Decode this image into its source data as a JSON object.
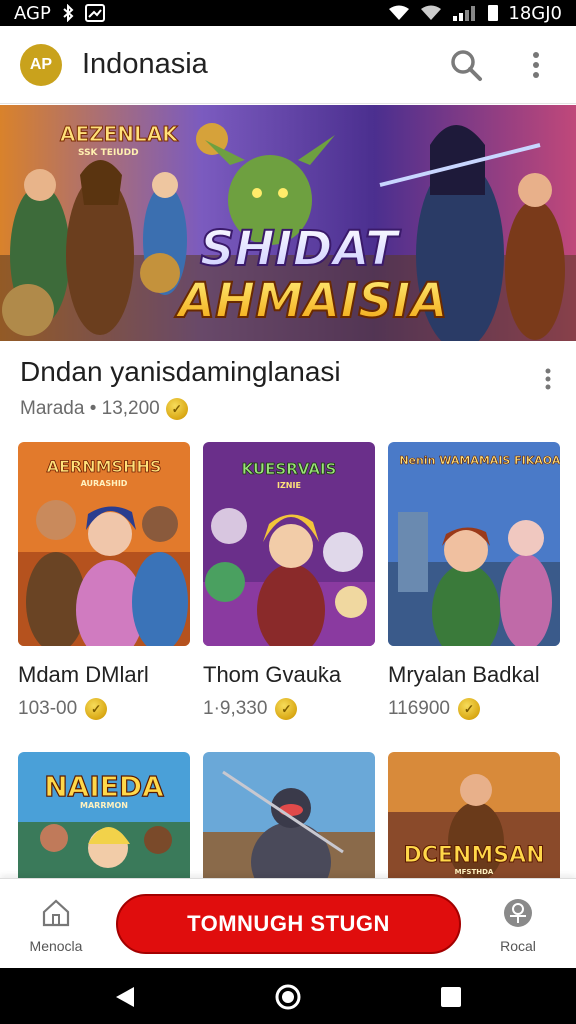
{
  "status_bar": {
    "left_text": "AGP",
    "time": "18GJ0"
  },
  "app_bar": {
    "avatar_initials": "AP",
    "title": "Indonasia"
  },
  "banner": {
    "logo_line1": "AEZENLAK",
    "logo_line2": "SSK TEIUDD",
    "title_line1": "SHIDAT",
    "title_line2": "AHMAISIA"
  },
  "section": {
    "title": "Dndan yanisdaminglanasi",
    "subtitle": "Marada • 13,200"
  },
  "games": [
    {
      "title": "Mdam DMlarl",
      "price": "103-00",
      "art_title": "AERNMSHHS",
      "art_sub": "AURASHID"
    },
    {
      "title": "Thom Gvauk̇a",
      "price": "1·9,330",
      "art_title": "KUESRVAIS",
      "art_sub": "IZNIE"
    },
    {
      "title": "Mryalan Badkal",
      "price": "116900",
      "art_title": "Nenin WAMAMAIS FIKAOABS",
      "art_sub": ""
    }
  ],
  "games_row2": [
    {
      "art_title": "NAIEDA",
      "art_sub": "MARRMON"
    },
    {
      "art_title": "",
      "art_sub": ""
    },
    {
      "art_title": "DCENMSAN",
      "art_sub": "MFSTHDA"
    }
  ],
  "bottom_bar": {
    "left_label": "Menocla",
    "cta_label": "TOMNUGH STUGN",
    "right_label": "Rocal"
  },
  "colors": {
    "accent": "#e00d0d",
    "coin": "#d9a814",
    "avatar": "#c9a21c"
  }
}
